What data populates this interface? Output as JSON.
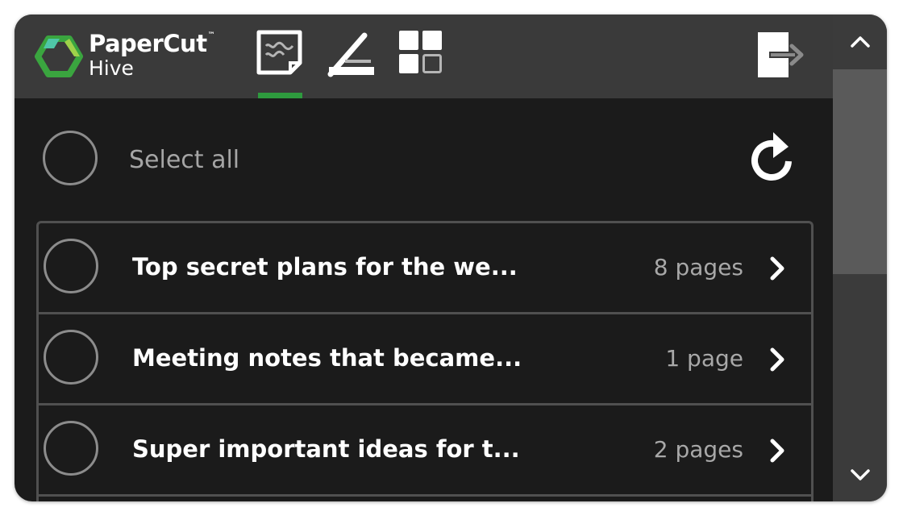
{
  "app": {
    "brand_line1": "PaperCut",
    "brand_tm": "™",
    "brand_line2": "Hive"
  },
  "toolbar": {
    "items": [
      {
        "icon": "documents-icon",
        "active": true
      },
      {
        "icon": "scan-icon",
        "active": false
      },
      {
        "icon": "apps-grid-icon",
        "active": false
      }
    ],
    "logout_icon": "logout-icon"
  },
  "colors": {
    "accent": "#2e9a3e",
    "topbar": "#3a3a3a",
    "background": "#1b1b1b",
    "scrollbar": "#3b3b3b",
    "scroll_thumb": "#5a5a5a"
  },
  "select_all": {
    "label": "Select all",
    "refresh_icon": "refresh-icon"
  },
  "jobs": [
    {
      "title": "Top secret plans for the we...",
      "pages": "8 pages"
    },
    {
      "title": "Meeting notes that became...",
      "pages": "1 page"
    },
    {
      "title": "Super important ideas for t...",
      "pages": "2 pages"
    }
  ],
  "scrollbar": {
    "up_icon": "chevron-up-icon",
    "down_icon": "chevron-down-icon"
  }
}
